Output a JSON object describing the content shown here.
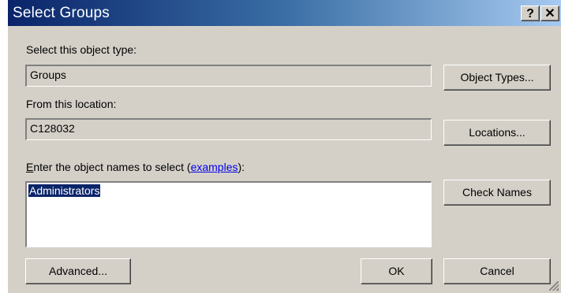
{
  "window": {
    "title": "Select Groups",
    "help_label": "?",
    "close_label": "✕"
  },
  "object_type": {
    "label": "Select this object type:",
    "value": "Groups",
    "button": "Object Types..."
  },
  "location": {
    "label": "From this location:",
    "value": "C128032",
    "button": "Locations..."
  },
  "names": {
    "label_e": "E",
    "label_rest": "nter the object names to select (",
    "label_link": "examples",
    "label_end": "):",
    "value": "Administrators",
    "button": "Check Names"
  },
  "footer": {
    "advanced": "Advanced...",
    "ok": "OK",
    "cancel": "Cancel"
  },
  "colors": {
    "title_start": "#0a246a",
    "title_end": "#a6caf0",
    "face": "#d4d0c8",
    "selection": "#0a246a"
  }
}
